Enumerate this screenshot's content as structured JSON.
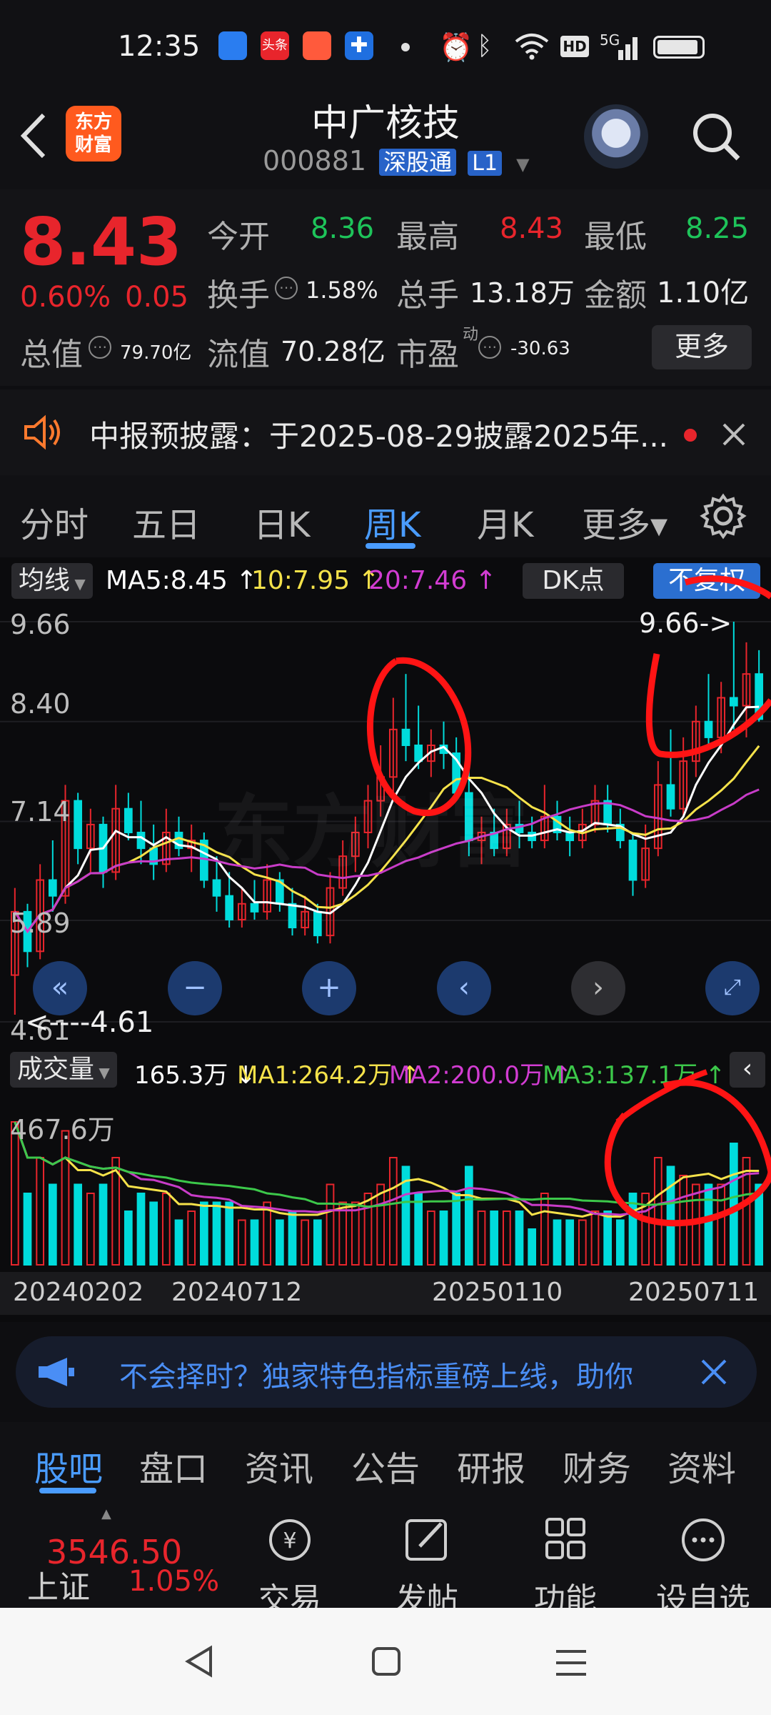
{
  "status_bar": {
    "time": "12:35",
    "icons": [
      "app-icon-blue",
      "toutiao-icon",
      "app-icon-orange",
      "app-icon-cross",
      "dot-icon",
      "alarm-icon",
      "bluetooth-icon",
      "wifi-icon",
      "hd-icon",
      "5g-signal-icon",
      "battery-icon"
    ],
    "toutiao_label": "头条",
    "hd_label": "HD",
    "net_label": "5G"
  },
  "header": {
    "logo_text_1": "东方",
    "logo_text_2": "财富",
    "stock_name": "中广核技",
    "stock_code": "000881",
    "badge_connect": "深股通",
    "badge_level": "L1"
  },
  "quote": {
    "price": "8.43",
    "change_pct": "0.60%",
    "change_amt": "0.05",
    "open_label": "今开",
    "open": "8.36",
    "high_label": "最高",
    "high": "8.43",
    "low_label": "最低",
    "low": "8.25",
    "turnover_label": "换手",
    "turnover": "1.58%",
    "volume_label": "总手",
    "volume": "13.18万",
    "amount_label": "金额",
    "amount": "1.10亿",
    "mktcap_label": "总值",
    "mktcap": "79.70亿",
    "float_label": "流值",
    "float_cap": "70.28亿",
    "pe_label": "市盈",
    "pe_sup": "动",
    "pe": "-30.63",
    "more_button": "更多"
  },
  "notice": {
    "text": "中报预披露：于2025-08-29披露2025年..."
  },
  "tabs": {
    "items": [
      "分时",
      "五日",
      "日K",
      "周K",
      "月K",
      "更多▾"
    ],
    "active_index": 3
  },
  "kline": {
    "ma_toggle": "均线",
    "ma5": "MA5:8.45",
    "ma10": "10:7.95",
    "ma20": "20:7.46",
    "dk_button": "DK点",
    "adjust_button": "不复权",
    "y_ticks": [
      "9.66",
      "8.40",
      "7.14",
      "5.89",
      "4.61"
    ],
    "max_label": "9.66->",
    "min_label": "<----4.61",
    "watermark": "东方财富",
    "colors": {
      "up": "#e8252c",
      "down": "#00dcdc",
      "ma5": "#ffffff",
      "ma10": "#f5e24a",
      "ma20": "#c83cc8"
    }
  },
  "volume": {
    "toggle": "成交量",
    "current": "165.3万",
    "ma1": "MA1:264.2万",
    "ma2": "MA2:200.0万",
    "ma3": "MA3:137.1万",
    "max_label": "467.6万",
    "dates": [
      "20240202",
      "20240712",
      "20250110",
      "20250711"
    ]
  },
  "banner": {
    "text": "不会择时？独家特色指标重磅上线，助你"
  },
  "subtabs": {
    "items": [
      "股吧",
      "盘口",
      "资讯",
      "公告",
      "研报",
      "财务",
      "资料"
    ],
    "active_index": 0
  },
  "bottom_bar": {
    "index_value": "3546.50",
    "index_name": "上证",
    "index_change": "1.05%",
    "buttons": [
      "交易",
      "发帖",
      "功能",
      "设自选"
    ]
  },
  "chart_data": {
    "type": "candlestick",
    "period": "weekly",
    "y_range": [
      4.61,
      9.66
    ],
    "y_ticks": [
      9.66,
      8.4,
      7.14,
      5.89,
      4.61
    ],
    "x_labels": [
      "20240202",
      "20240712",
      "20250110",
      "20250711"
    ],
    "candles": [
      [
        5.2,
        6.3,
        4.7,
        6.0
      ],
      [
        6.0,
        6.1,
        5.3,
        5.5
      ],
      [
        5.5,
        6.6,
        5.4,
        6.4
      ],
      [
        6.4,
        6.9,
        6.0,
        6.2
      ],
      [
        6.2,
        7.6,
        6.1,
        7.4
      ],
      [
        7.4,
        7.5,
        6.6,
        6.8
      ],
      [
        6.8,
        7.3,
        6.5,
        7.1
      ],
      [
        7.1,
        7.2,
        6.3,
        6.5
      ],
      [
        6.5,
        7.6,
        6.4,
        7.3
      ],
      [
        7.3,
        7.5,
        6.9,
        7.0
      ],
      [
        7.0,
        7.4,
        6.6,
        6.8
      ],
      [
        6.8,
        7.1,
        6.4,
        6.6
      ],
      [
        6.6,
        7.3,
        6.5,
        7.0
      ],
      [
        7.0,
        7.2,
        6.7,
        6.8
      ],
      [
        6.8,
        7.1,
        6.5,
        6.9
      ],
      [
        6.9,
        7.0,
        6.3,
        6.4
      ],
      [
        6.4,
        6.7,
        6.0,
        6.2
      ],
      [
        6.2,
        6.5,
        5.8,
        5.9
      ],
      [
        5.9,
        6.3,
        5.8,
        6.1
      ],
      [
        6.1,
        6.4,
        5.9,
        6.0
      ],
      [
        6.0,
        6.6,
        5.9,
        6.4
      ],
      [
        6.4,
        6.5,
        6.0,
        6.1
      ],
      [
        6.1,
        6.3,
        5.7,
        5.8
      ],
      [
        5.8,
        6.2,
        5.7,
        6.0
      ],
      [
        6.0,
        6.1,
        5.6,
        5.7
      ],
      [
        5.7,
        6.5,
        5.6,
        6.3
      ],
      [
        6.3,
        6.9,
        6.2,
        6.7
      ],
      [
        6.7,
        7.2,
        6.5,
        7.0
      ],
      [
        7.0,
        7.6,
        6.8,
        7.4
      ],
      [
        7.4,
        8.1,
        7.2,
        7.7
      ],
      [
        7.7,
        8.7,
        7.5,
        8.3
      ],
      [
        8.3,
        9.0,
        7.9,
        8.1
      ],
      [
        8.1,
        8.6,
        7.8,
        7.9
      ],
      [
        7.9,
        8.3,
        7.7,
        8.1
      ],
      [
        8.1,
        8.4,
        7.8,
        8.0
      ],
      [
        8.0,
        8.2,
        7.4,
        7.5
      ],
      [
        7.5,
        7.8,
        6.7,
        6.9
      ],
      [
        6.9,
        7.2,
        6.6,
        7.0
      ],
      [
        7.0,
        7.3,
        6.7,
        6.8
      ],
      [
        6.8,
        7.3,
        6.7,
        7.1
      ],
      [
        7.1,
        7.4,
        6.8,
        7.0
      ],
      [
        7.0,
        7.2,
        6.8,
        6.9
      ],
      [
        6.9,
        7.6,
        6.8,
        7.2
      ],
      [
        7.2,
        7.4,
        6.9,
        7.0
      ],
      [
        7.0,
        7.2,
        6.7,
        6.9
      ],
      [
        6.9,
        7.3,
        6.8,
        7.1
      ],
      [
        7.1,
        7.6,
        7.0,
        7.4
      ],
      [
        7.4,
        7.6,
        7.0,
        7.1
      ],
      [
        7.1,
        7.3,
        6.8,
        6.9
      ],
      [
        6.9,
        7.0,
        6.2,
        6.4
      ],
      [
        6.4,
        7.1,
        6.3,
        6.8
      ],
      [
        6.8,
        7.9,
        6.7,
        7.6
      ],
      [
        7.6,
        8.3,
        7.2,
        7.3
      ],
      [
        7.3,
        8.2,
        7.2,
        7.9
      ],
      [
        7.9,
        8.6,
        7.7,
        8.4
      ],
      [
        8.4,
        9.0,
        8.1,
        8.2
      ],
      [
        8.2,
        8.9,
        8.0,
        8.7
      ],
      [
        8.7,
        9.66,
        8.3,
        8.6
      ],
      [
        8.6,
        9.4,
        8.2,
        9.0
      ],
      [
        9.0,
        9.3,
        8.4,
        8.43
      ]
    ]
  }
}
